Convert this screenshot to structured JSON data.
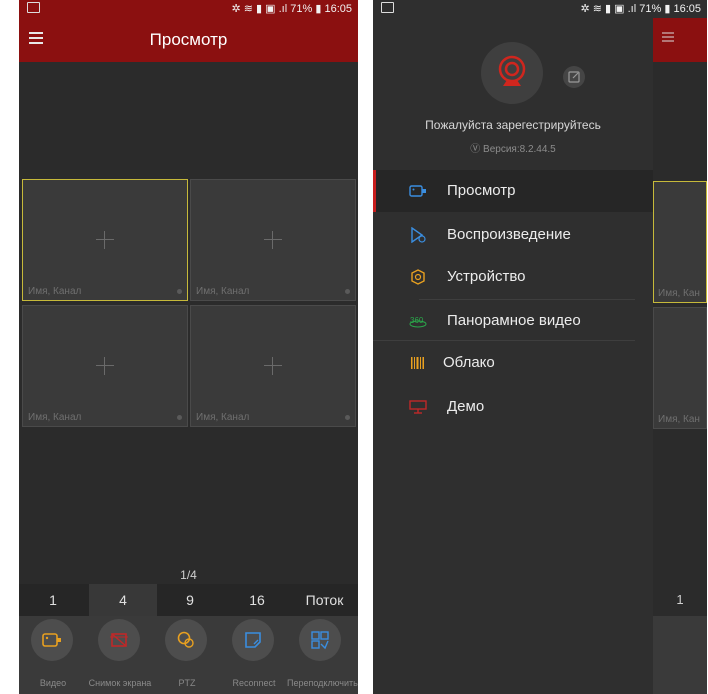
{
  "status": {
    "time": "16:05",
    "battery": "71%",
    "icons": "✲ ≋ ▮ ▣ .ıl"
  },
  "left": {
    "title": "Просмотр",
    "cells": [
      {
        "label": "Имя, Канал",
        "selected": true
      },
      {
        "label": "Имя, Канал",
        "selected": false
      },
      {
        "label": "Имя, Канал",
        "selected": false
      },
      {
        "label": "Имя, Канал",
        "selected": false
      }
    ],
    "page_indicator": "1/4",
    "layouts": [
      "1",
      "4",
      "9",
      "16",
      "Поток"
    ],
    "active_layout": "4",
    "tools": [
      "Видео",
      "Снимок экрана",
      "PTZ",
      "Reconnect",
      "Переподключиться"
    ]
  },
  "drawer": {
    "login": "Пожалуйста зарегестрируйтесь",
    "version": "Версия:8.2.44.5",
    "items": [
      {
        "label": "Просмотр",
        "icon": "live-view-icon",
        "active": true
      },
      {
        "label": "Воспроизведение",
        "icon": "playback-icon",
        "active": false
      },
      {
        "label": "Устройство",
        "icon": "device-gear-icon",
        "active": false
      },
      {
        "label": "Панорамное видео",
        "icon": "panorama-360-icon",
        "active": false
      },
      {
        "label": "Облако",
        "icon": "cloud-barcode-icon",
        "active": false
      },
      {
        "label": "Демо",
        "icon": "demo-icon",
        "active": false
      }
    ],
    "peek": {
      "cell_label": "Имя, Кан",
      "layout_num": "1"
    }
  },
  "colors": {
    "brand": "#8b1010",
    "accent_active": "#c81e1e",
    "selected_cell": "#c6b93a"
  }
}
